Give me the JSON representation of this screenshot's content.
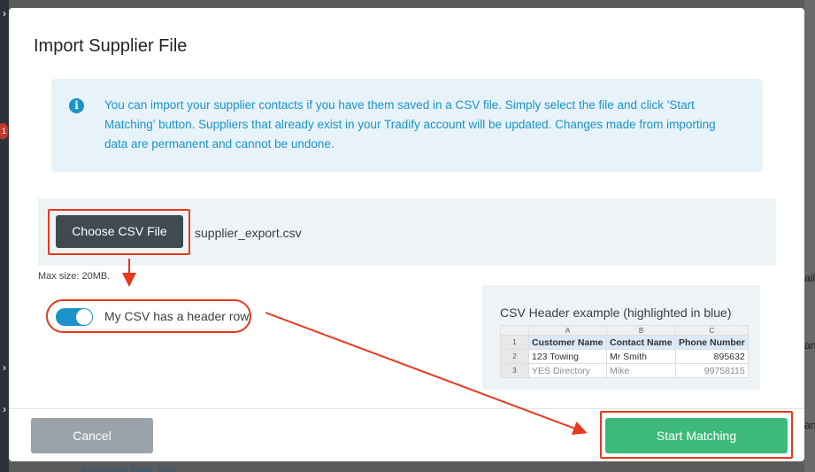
{
  "background": {
    "left_marks": [
      "›",
      "›",
      "›"
    ],
    "badge": "1",
    "right_fragments": [
      "ail",
      "an",
      "an"
    ],
    "bottom_link": "Imported from Xero"
  },
  "modal": {
    "title": "Import Supplier File",
    "info_text": "You can import your supplier contacts if you have them saved in a CSV file. Simply select the file and click 'Start Matching' button. Suppliers that already exist in your Tradify account will be updated. Changes made from importing data are permanent and cannot be undone.",
    "choose_button": "Choose CSV File",
    "file_name": "supplier_export.csv",
    "max_size": "Max size: 20MB.",
    "header_toggle": {
      "label": "My CSV has a header row",
      "checked": true
    },
    "example": {
      "title": "CSV Header example (highlighted in blue)",
      "columns": [
        "A",
        "B",
        "C"
      ],
      "rows": [
        {
          "n": "1",
          "cells": [
            "Customer Name",
            "Contact Name",
            "Phone Number"
          ]
        },
        {
          "n": "2",
          "cells": [
            "123 Towing",
            "Mr Smith",
            "895632"
          ]
        },
        {
          "n": "3",
          "cells": [
            "YES Directory",
            "Mike",
            "99758115"
          ]
        }
      ]
    },
    "cancel_button": "Cancel",
    "start_button": "Start Matching"
  },
  "colors": {
    "annotation_red": "#e8381e",
    "info_blue": "#1c93c8",
    "start_green": "#3dba7a",
    "choose_dark": "#3f4a52",
    "cancel_gray": "#9aa3a9"
  }
}
